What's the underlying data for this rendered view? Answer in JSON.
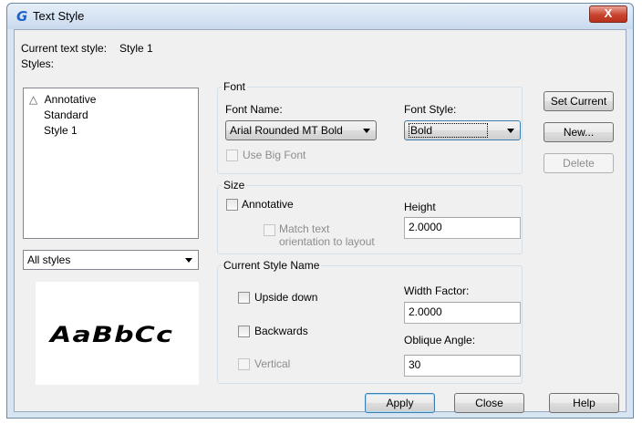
{
  "window": {
    "title": "Text Style",
    "app_icon": "G",
    "close_glyph": "X"
  },
  "current_style": {
    "label": "Current text style:",
    "value": "Style 1"
  },
  "styles": {
    "label": "Styles:",
    "items": [
      "Annotative",
      "Standard",
      "Style 1"
    ]
  },
  "filter": {
    "value": "All styles"
  },
  "preview": {
    "text": "AaBbCc"
  },
  "font": {
    "group_title": "Font",
    "name_label": "Font Name:",
    "name_value": "Arial Rounded MT Bold",
    "style_label": "Font Style:",
    "style_value": "Bold",
    "big_font_label": "Use Big Font"
  },
  "size": {
    "group_title": "Size",
    "annotative_label": "Annotative",
    "match_label_line1": "Match text",
    "match_label_line2": "orientation to layout",
    "height_label": "Height",
    "height_value": "2.0000"
  },
  "effects": {
    "group_title": "Current Style Name",
    "upside_down_label": "Upside down",
    "backwards_label": "Backwards",
    "vertical_label": "Vertical",
    "width_factor_label": "Width Factor:",
    "width_factor_value": "2.0000",
    "oblique_label": "Oblique Angle:",
    "oblique_value": "30"
  },
  "buttons": {
    "set_current": "Set Current",
    "new": "New...",
    "delete": "Delete",
    "apply": "Apply",
    "close": "Close",
    "help": "Help"
  },
  "colors": {
    "accent": "#1e63c8",
    "close_button": "#c8442f",
    "window_frame": "#d7e4f2"
  }
}
